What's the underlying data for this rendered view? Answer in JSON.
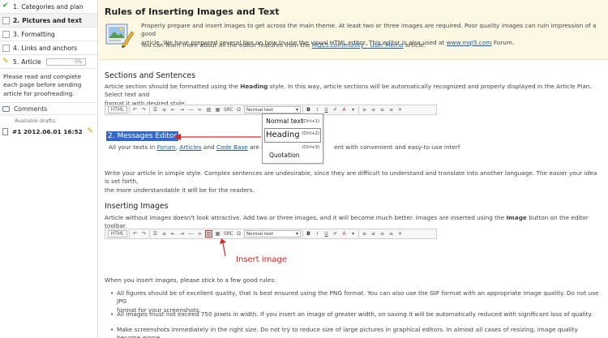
{
  "sidebar": {
    "steps": [
      {
        "number": "1.",
        "label": "Categories and plan",
        "state": "done"
      },
      {
        "number": "2.",
        "label": "Pictures and text",
        "state": "active"
      },
      {
        "number": "3.",
        "label": "Formatting",
        "state": "todo"
      },
      {
        "number": "4.",
        "label": "Links and anchors",
        "state": "todo"
      },
      {
        "number": "5.",
        "label": "Article",
        "state": "current"
      }
    ],
    "progress_text": "0%",
    "progress_value": 0,
    "note": "Please read and complete each page before sending article for proofreading.",
    "comments_label": "Comments",
    "drafts_label": "Available drafts:",
    "draft_item": "#1 2012.06.01 16:52"
  },
  "header": {
    "title": "Rules of Inserting Images and Text",
    "para1_a": "Properly prepare and insert images to get across the main theme. At least two or three images are required. Poor quality images can ruin impression of a good",
    "para1_b": "article. We have prepared several tips on how to use the visual HTML editor. This editor is also used at ",
    "para1_link": "www.mql5.com",
    "para1_c": " Forum.",
    "para2_a": "You can learn more about all the editor features from the ",
    "para2_link": "MQL5.community - User Memo",
    "para2_b": " article."
  },
  "sections_block": {
    "title": "Sections and Sentences",
    "line1_a": "Article section should be formatted using the ",
    "line1_bold": "Heading",
    "line1_b": " style. In this way, article sections will be automatically recognized and properly displayed in the Article Plan. Select text and",
    "line2": "format it with desired style:",
    "demo_heading": "2. Messages Editor",
    "line3_a": "All your texts in ",
    "link_forum": "Forum",
    "sep1": ", ",
    "link_articles": "Articles",
    "sep2": " and ",
    "link_codebase": "Code Base",
    "line3_b": " are edite",
    "line3_c": "ent with convenient and easy-to-use interf",
    "para_a": "Write your article in simple style. Complex sentences are undesirable, since they are difficult to understand and translate into another language. The easier your idea is set forth,",
    "para_b": "the more understandable it will be for the readers."
  },
  "toolbar": {
    "html_label": "HTML",
    "src_label": "SRC",
    "format_value": "Normal text",
    "bold_label": "B",
    "italic_label": "I",
    "underline_label": "U",
    "color_label": "A",
    "undo_glyph": "↶",
    "redo_glyph": "↷"
  },
  "dropdown": {
    "items": [
      {
        "label": "Normal text",
        "shortcut": "(Ctrl+1)"
      },
      {
        "label": "Heading",
        "shortcut": "(Ctrl+2)"
      },
      {
        "label": "Quotation",
        "shortcut": "(Ctrl+3)"
      }
    ]
  },
  "images_block": {
    "title": "Inserting Images",
    "line1_a": "Article without images doesn't look attractive. Add two or three images, and it will become much better. Images are inserted using the ",
    "line1_bold": "Image",
    "line1_b": " button on the editor toolbar.",
    "annotation": "Insert image",
    "rules_intro": "When you insert images, please stick to a few good rules:",
    "bullets": [
      {
        "a": "All figures should be of excellent quality, that is best ensured using the PNG format. You can also use the GIF format with an appropriate image quality. Do not use JPG",
        "b": "format for your screenshots."
      },
      {
        "a": "All images must not exceed 750 pixels in width. If you insert an image of greater width, on saving it will be automatically reduced with significant loss of quality.",
        "b": ""
      },
      {
        "a": "Make screenshots immediately in the right size. Do not try to reduce size of large pictures in graphical editors. In almost all cases of resizing, image quality become worse.",
        "b": ""
      }
    ]
  },
  "colors": {
    "header_bg": "#fdf8e4",
    "link": "#1a5aa8",
    "highlight": "#3368c8",
    "annotation_red": "#d62828",
    "check_green": "#2f9a2f"
  }
}
